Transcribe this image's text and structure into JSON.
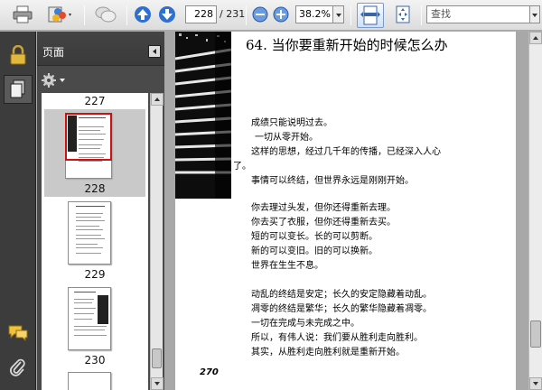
{
  "toolbar": {
    "current_page": "228",
    "page_total": "/ 231",
    "zoom": "38.2%",
    "search_placeholder": "查找"
  },
  "panel": {
    "title": "页面",
    "thumbnails": [
      {
        "label": "227"
      },
      {
        "label": "228"
      },
      {
        "label": "229"
      },
      {
        "label": "230"
      }
    ]
  },
  "document": {
    "title": "64. 当你要重新开始的时候怎么办",
    "lines": [
      "成绩只能说明过去。",
      "一切从零开始。",
      "这样的思想，经过几千年的传播，已经深入人心",
      "了。",
      "事情可以终结，但世界永远是刚刚开始。",
      "你去理过头发，但你还得重新去理。",
      "你去买了衣服，但你还得重新去买。",
      "短的可以变长。长的可以剪断。",
      "新的可以变旧。旧的可以换新。",
      "世界在生生不息。",
      "动乱的终结是安定；长久的安定隐藏着动乱。",
      "凋零的终结是繁华；长久的繁华隐藏着凋零。",
      "一切在完成与未完成之中。",
      "所以，有伟人说：我们要从胜利走向胜利。",
      "其实，从胜利走向胜利就是重新开始。"
    ],
    "page_number": "270"
  },
  "colors": {
    "selection_border": "#d01010",
    "rail_bg": "#3c3c3c",
    "nav_arrow": "#2f6fd0"
  }
}
